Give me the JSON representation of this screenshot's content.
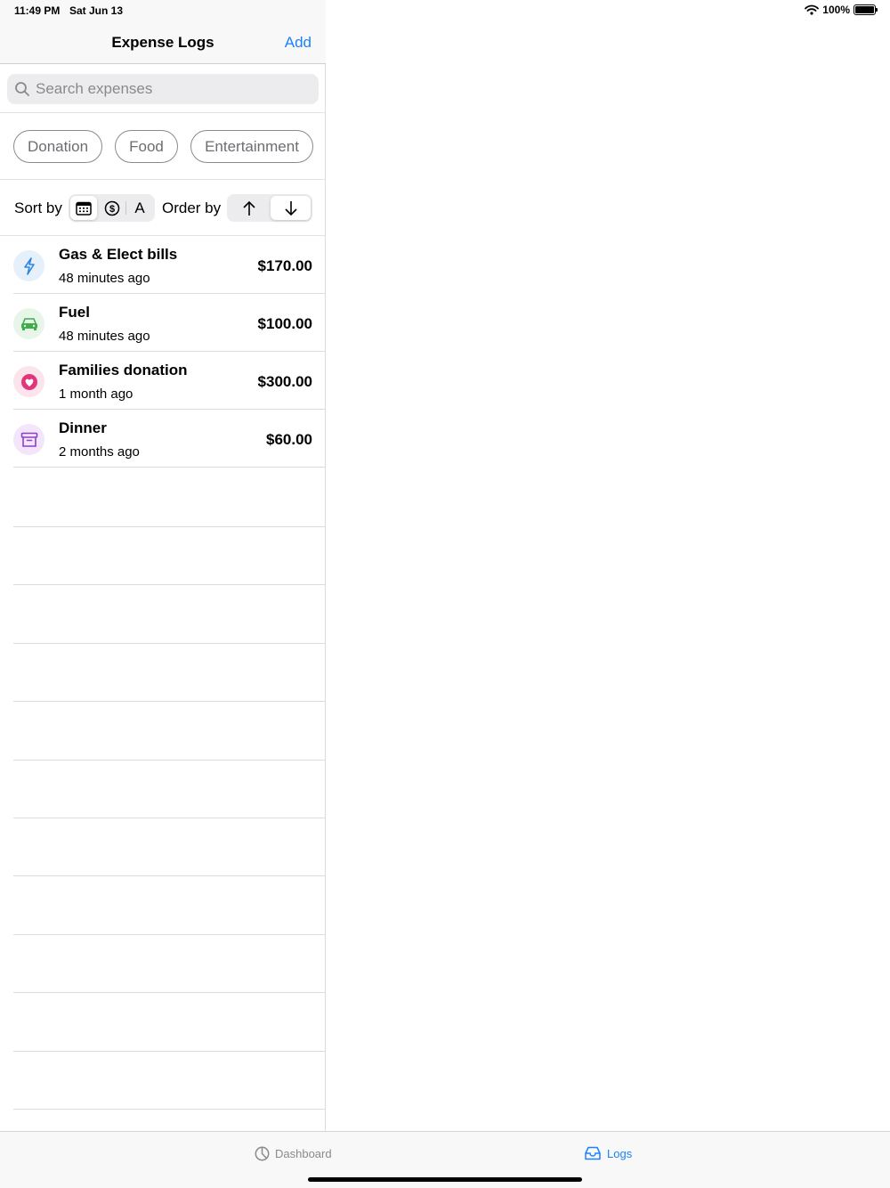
{
  "status_bar": {
    "time": "11:49 PM",
    "date": "Sat Jun 13",
    "battery": "100%",
    "battery_level": 1.0
  },
  "nav": {
    "title": "Expense Logs",
    "add_label": "Add"
  },
  "search": {
    "placeholder": "Search expenses"
  },
  "filters": [
    "Donation",
    "Food",
    "Entertainment"
  ],
  "sort": {
    "sort_label": "Sort by",
    "options": [
      "calendar-icon",
      "dollar-icon",
      "A"
    ],
    "selected_sort": 0,
    "order_label": "Order by",
    "order_options": [
      "arrow-up-icon",
      "arrow-down-icon"
    ],
    "selected_order": 1
  },
  "expenses": [
    {
      "title": "Gas & Elect bills",
      "time": "48 minutes ago",
      "amount": "$170.00",
      "icon": "bolt-icon",
      "color": "#2e86de",
      "bg": "#e6f0fb"
    },
    {
      "title": "Fuel",
      "time": "48 minutes ago",
      "amount": "$100.00",
      "icon": "car-icon",
      "color": "#3fae49",
      "bg": "#e8f5e9"
    },
    {
      "title": "Families donation",
      "time": "1 month ago",
      "amount": "$300.00",
      "icon": "heart-icon",
      "color": "#e0367a",
      "bg": "#fce4ec"
    },
    {
      "title": "Dinner",
      "time": "2 months ago",
      "amount": "$60.00",
      "icon": "archive-icon",
      "color": "#8e3fc9",
      "bg": "#f3e5fb"
    }
  ],
  "tabs": [
    {
      "label": "Dashboard",
      "icon": "chart-pie-icon",
      "selected": false
    },
    {
      "label": "Logs",
      "icon": "inbox-icon",
      "selected": true
    }
  ],
  "colors": {
    "accent": "#1a82fb",
    "inactive_tab": "#8a8a8e"
  }
}
